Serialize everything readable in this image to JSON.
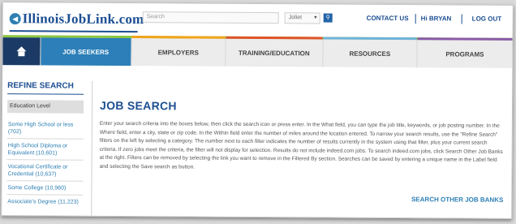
{
  "header": {
    "logo_text": "IllinoisJobLink.com",
    "search_placeholder": "Search",
    "location_value": "Joliet",
    "contact_label": "CONTACT US",
    "greeting": "Hi BRYAN",
    "logout_label": "LOG OUT"
  },
  "nav": {
    "items": [
      {
        "label": "JOB SEEKERS",
        "active": true
      },
      {
        "label": "EMPLOYERS"
      },
      {
        "label": "TRAINING/EDUCATION"
      },
      {
        "label": "RESOURCES"
      },
      {
        "label": "PROGRAMS"
      }
    ],
    "colors": [
      "#8dc63f",
      "#f2a31b",
      "#e0542a",
      "#6fb3d9",
      "#8a5aa8"
    ]
  },
  "sidebar": {
    "title": "REFINE SEARCH",
    "section_label": "Education Level",
    "items": [
      "Some High School or less (702)",
      "High School Diploma or Equivalent (10,601)",
      "Vocational Certificate or Credential (10,637)",
      "Some College (10,960)",
      "Associate's Degree (11,223)"
    ]
  },
  "main": {
    "title": "JOB SEARCH",
    "description": "Enter your search criteria into the boxes below, then click the search icon or press enter. In the What field, you can type the job title, keywords, or job posting number. In the Where field, enter a city, state or zip code. In the Within field enter the number of miles around the location entered. To narrow your search results, use the \"Refine Search\" filters on the left by selecting a category. The number next to each filter indicates the number of results currently in the system using that filter, plus your current search criteria. If zero jobs meet the criteria, the filter will not display for selection. Results do not include indeed.com jobs. To search indeed.com jobs, click Search Other Job Banks at the right. Filters can be removed by selecting the link you want to remove in the Filtered By section. Searches can be saved by entering a unique name in the Label field and selecting the Save search as button.",
    "other_link": "SEARCH OTHER JOB BANKS"
  }
}
